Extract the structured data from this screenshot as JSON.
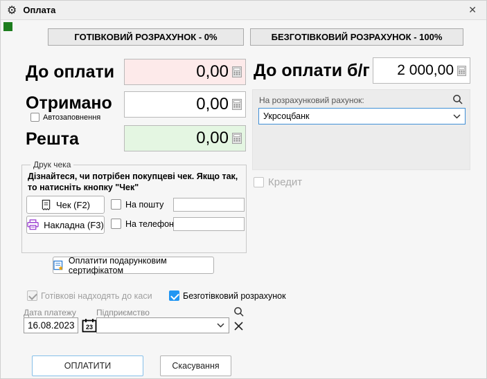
{
  "window": {
    "title": "Оплата"
  },
  "icons": {
    "gear": "⚙",
    "close": "✕"
  },
  "tabs": {
    "cash_label": "ГОТІВКОВИЙ РОЗРАХУНОК - 0%",
    "cashless_label": "БЕЗГОТІВКОВИЙ РОЗРАХУНОК - 100%"
  },
  "cash_panel": {
    "to_pay_label": "До оплати",
    "to_pay_value": "0,00",
    "received_label": "Отримано",
    "received_value": "0,00",
    "autofill_label": "Автозаповнення",
    "autofill_checked": false,
    "change_label": "Решта",
    "change_value": "0,00"
  },
  "cashless_panel": {
    "to_pay_label": "До оплати б/г",
    "to_pay_value": "2 000,00",
    "account_label": "На розрахунковий рахунок:",
    "account_value": "Укрсоцбанк",
    "credit_label": "Кредит",
    "credit_checked": false
  },
  "receipt_group": {
    "legend": "Друк чека",
    "hint": "Дізнайтеся, чи потрібен покупцеві чек. Якщо так, то натисніть кнопку \"Чек\"",
    "receipt_button_label": "Чек (F2)",
    "invoice_button_label": "Накладна (F3)",
    "email_label": "На пошту",
    "email_checked": false,
    "email_value": "",
    "phone_label": "На телефон",
    "phone_checked": false,
    "phone_value": ""
  },
  "gift_button_label": "Оплатити подарунковим сертифікатом",
  "options": {
    "cash_to_register_label": "Готівкові надходять до каси",
    "cash_to_register_checked": true,
    "cashless_label": "Безготівковий розрахунок",
    "cashless_checked": true
  },
  "payment_meta": {
    "date_label": "Дата платежу",
    "date_value": "16.08.2023",
    "calendar_day": "23",
    "enterprise_label": "Підприємство",
    "enterprise_value": ""
  },
  "footer": {
    "pay_label": "ОПЛАТИТИ",
    "cancel_label": "Скасування"
  },
  "colors": {
    "focus_blue": "#3f8fd6",
    "checkbox_blue": "#2196f3",
    "field_pink": "#fdeaea",
    "field_green": "#e4f6e2",
    "status_green": "#1d7d1e",
    "printer_purple": "#9b3fd1",
    "doc_blue": "#2b7cd3",
    "star_orange": "#f0a30a"
  }
}
